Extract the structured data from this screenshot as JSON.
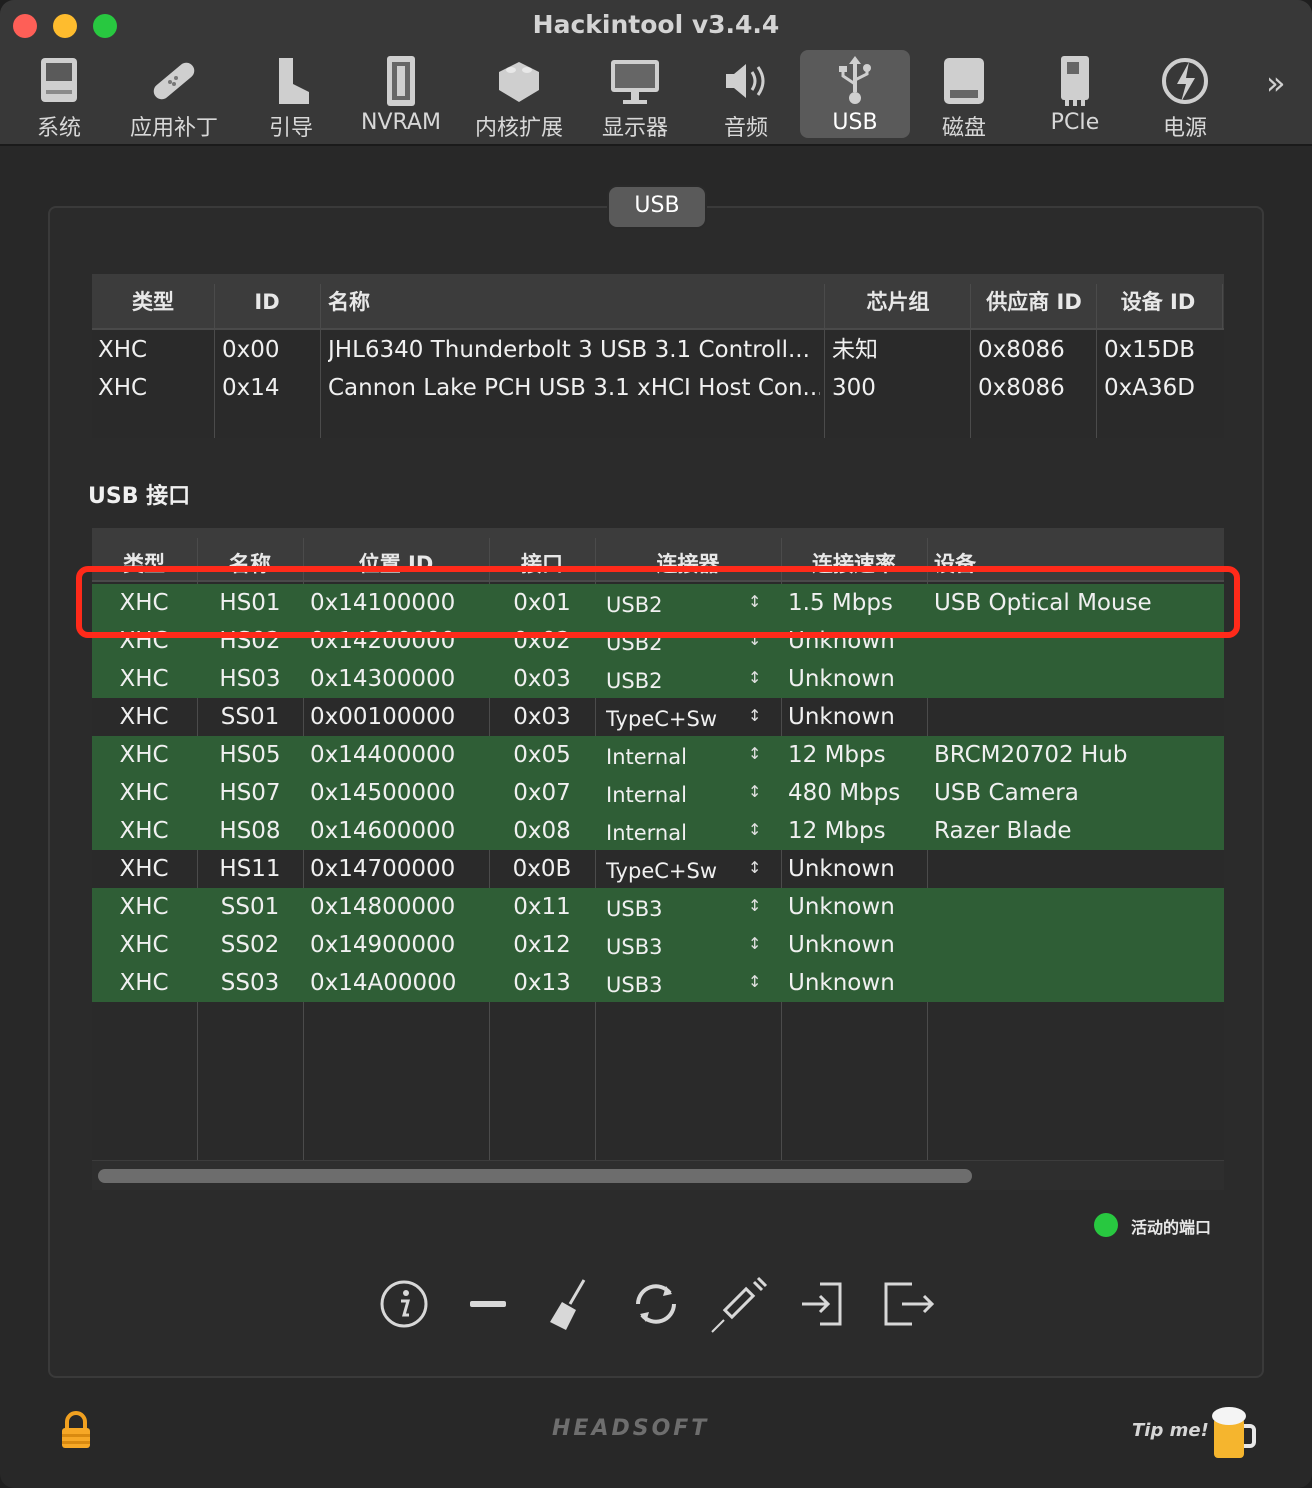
{
  "window": {
    "title": "Hackintool v3.4.4"
  },
  "toolbar": {
    "items": [
      {
        "label": "系统",
        "icon": "system-icon"
      },
      {
        "label": "应用补丁",
        "icon": "patch-icon"
      },
      {
        "label": "引导",
        "icon": "boot-icon"
      },
      {
        "label": "NVRAM",
        "icon": "nvram-icon"
      },
      {
        "label": "内核扩展",
        "icon": "kext-icon"
      },
      {
        "label": "显示器",
        "icon": "display-icon"
      },
      {
        "label": "音频",
        "icon": "audio-icon"
      },
      {
        "label": "USB",
        "icon": "usb-icon",
        "active": true
      },
      {
        "label": "磁盘",
        "icon": "disk-icon"
      },
      {
        "label": "PCIe",
        "icon": "pcie-icon"
      },
      {
        "label": "电源",
        "icon": "power-icon"
      }
    ],
    "more": "»"
  },
  "group_tab": "USB",
  "controllers": {
    "headers": [
      "类型",
      "ID",
      "名称",
      "芯片组",
      "供应商 ID",
      "设备 ID"
    ],
    "rows": [
      [
        "XHC",
        "0x00",
        "JHL6340 Thunderbolt 3 USB 3.1 Controll...",
        "未知",
        "0x8086",
        "0x15DB"
      ],
      [
        "XHC",
        "0x14",
        "Cannon Lake PCH USB 3.1 xHCI Host Con...",
        "300",
        "0x8086",
        "0xA36D"
      ]
    ]
  },
  "ports_section_label": "USB 接口",
  "ports": {
    "headers": [
      "类型",
      "名称",
      "位置 ID",
      "接口",
      "连接器",
      "连接速率",
      "设备"
    ],
    "rows": [
      {
        "type": "XHC",
        "name": "HS01",
        "location": "0x14100000",
        "port": "0x01",
        "connector": "USB2",
        "speed": "1.5 Mbps",
        "device": "USB Optical Mouse",
        "active": true
      },
      {
        "type": "XHC",
        "name": "HS02",
        "location": "0x14200000",
        "port": "0x02",
        "connector": "USB2",
        "speed": "Unknown",
        "device": "",
        "active": true
      },
      {
        "type": "XHC",
        "name": "HS03",
        "location": "0x14300000",
        "port": "0x03",
        "connector": "USB2",
        "speed": "Unknown",
        "device": "",
        "active": true
      },
      {
        "type": "XHC",
        "name": "SS01",
        "location": "0x00100000",
        "port": "0x03",
        "connector": "TypeC+Sw",
        "speed": "Unknown",
        "device": "",
        "active": false
      },
      {
        "type": "XHC",
        "name": "HS05",
        "location": "0x14400000",
        "port": "0x05",
        "connector": "Internal",
        "speed": "12 Mbps",
        "device": "BRCM20702 Hub",
        "active": true
      },
      {
        "type": "XHC",
        "name": "HS07",
        "location": "0x14500000",
        "port": "0x07",
        "connector": "Internal",
        "speed": "480 Mbps",
        "device": "USB Camera",
        "active": true
      },
      {
        "type": "XHC",
        "name": "HS08",
        "location": "0x14600000",
        "port": "0x08",
        "connector": "Internal",
        "speed": "12 Mbps",
        "device": "Razer Blade",
        "active": true
      },
      {
        "type": "XHC",
        "name": "HS11",
        "location": "0x14700000",
        "port": "0x0B",
        "connector": "TypeC+Sw",
        "speed": "Unknown",
        "device": "",
        "active": false
      },
      {
        "type": "XHC",
        "name": "SS01",
        "location": "0x14800000",
        "port": "0x11",
        "connector": "USB3",
        "speed": "Unknown",
        "device": "",
        "active": true
      },
      {
        "type": "XHC",
        "name": "SS02",
        "location": "0x14900000",
        "port": "0x12",
        "connector": "USB3",
        "speed": "Unknown",
        "device": "",
        "active": true
      },
      {
        "type": "XHC",
        "name": "SS03",
        "location": "0x14A00000",
        "port": "0x13",
        "connector": "USB3",
        "speed": "Unknown",
        "device": "",
        "active": true
      }
    ]
  },
  "legend": {
    "label": "活动的端口",
    "color": "#28c840"
  },
  "actions": [
    "info-icon",
    "remove-icon",
    "clear-icon",
    "refresh-icon",
    "inject-icon",
    "import-icon",
    "export-icon"
  ],
  "footer": {
    "brand": "HEADSOFT",
    "tip": "Tip me!"
  },
  "colors": {
    "active_row": "#2f5e36",
    "highlight": "#ff2a1a",
    "background": "#282828"
  }
}
